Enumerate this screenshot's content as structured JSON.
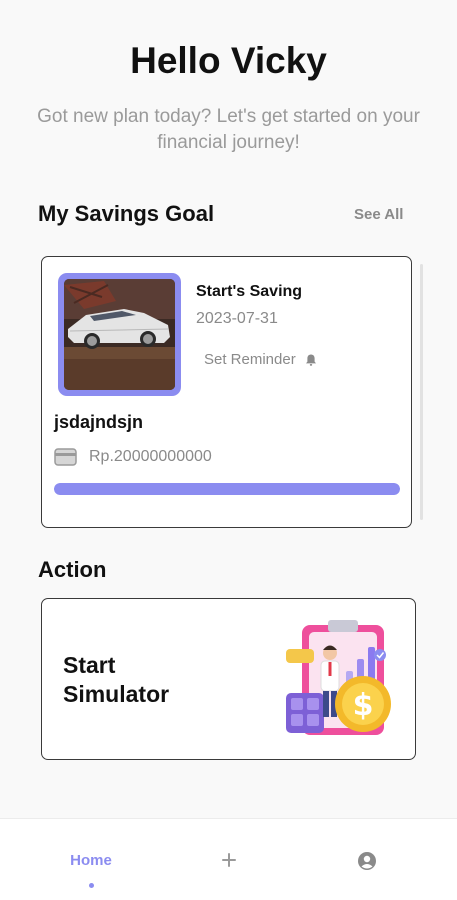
{
  "header": {
    "greeting": "Hello Vicky",
    "subtitle": "Got new plan today? Let's get started on your financial journey!"
  },
  "savings": {
    "section_title": "My Savings Goal",
    "see_all_label": "See All",
    "goal": {
      "title": "Start's Saving",
      "date": "2023-07-31",
      "reminder_label": "Set Reminder",
      "reminder_icon": "bell-icon",
      "name": "jsdajndsjn",
      "amount": "Rp.20000000000",
      "amount_icon": "wallet-icon",
      "progress": 1.0
    }
  },
  "action": {
    "section_title": "Action",
    "simulator_label": "Start Simulator",
    "illustration": "financial-simulator-illustration"
  },
  "nav": {
    "home_label": "Home",
    "add_icon": "plus-icon",
    "profile_icon": "user-circle-icon"
  },
  "colors": {
    "accent": "#8b8cf0",
    "text": "#111111",
    "muted": "#8a8a8a",
    "background": "#f9f9f9"
  }
}
